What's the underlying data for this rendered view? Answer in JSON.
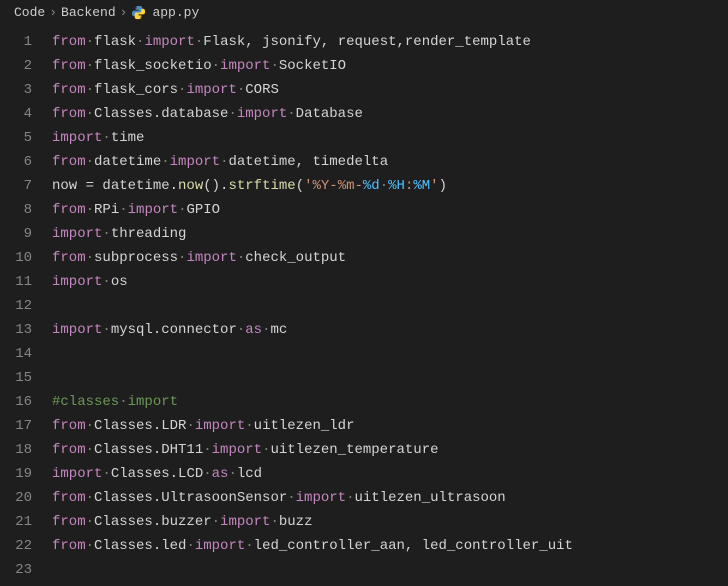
{
  "breadcrumb": {
    "items": [
      "Code",
      "Backend",
      "app.py"
    ],
    "file_icon": "python-icon"
  },
  "editor": {
    "lines": [
      {
        "num": "1",
        "tokens": [
          {
            "t": "from",
            "c": "keyword"
          },
          {
            "t": "·",
            "c": "dim"
          },
          {
            "t": "flask",
            "c": "module"
          },
          {
            "t": "·",
            "c": "dim"
          },
          {
            "t": "import",
            "c": "keyword"
          },
          {
            "t": "·",
            "c": "dim"
          },
          {
            "t": "Flask, jsonify, request,render_template",
            "c": "text"
          }
        ]
      },
      {
        "num": "2",
        "tokens": [
          {
            "t": "from",
            "c": "keyword"
          },
          {
            "t": "·",
            "c": "dim"
          },
          {
            "t": "flask_socketio",
            "c": "module"
          },
          {
            "t": "·",
            "c": "dim"
          },
          {
            "t": "import",
            "c": "keyword"
          },
          {
            "t": "·",
            "c": "dim"
          },
          {
            "t": "SocketIO",
            "c": "text"
          }
        ]
      },
      {
        "num": "3",
        "tokens": [
          {
            "t": "from",
            "c": "keyword"
          },
          {
            "t": "·",
            "c": "dim"
          },
          {
            "t": "flask_cors",
            "c": "module"
          },
          {
            "t": "·",
            "c": "dim"
          },
          {
            "t": "import",
            "c": "keyword"
          },
          {
            "t": "·",
            "c": "dim"
          },
          {
            "t": "CORS",
            "c": "text"
          }
        ]
      },
      {
        "num": "4",
        "tokens": [
          {
            "t": "from",
            "c": "keyword"
          },
          {
            "t": "·",
            "c": "dim"
          },
          {
            "t": "Classes.database",
            "c": "module"
          },
          {
            "t": "·",
            "c": "dim"
          },
          {
            "t": "import",
            "c": "keyword"
          },
          {
            "t": "·",
            "c": "dim"
          },
          {
            "t": "Database",
            "c": "text"
          }
        ]
      },
      {
        "num": "5",
        "tokens": [
          {
            "t": "import",
            "c": "keyword"
          },
          {
            "t": "·",
            "c": "dim"
          },
          {
            "t": "time",
            "c": "module"
          }
        ]
      },
      {
        "num": "6",
        "tokens": [
          {
            "t": "from",
            "c": "keyword"
          },
          {
            "t": "·",
            "c": "dim"
          },
          {
            "t": "datetime",
            "c": "module"
          },
          {
            "t": "·",
            "c": "dim"
          },
          {
            "t": "import",
            "c": "keyword"
          },
          {
            "t": "·",
            "c": "dim"
          },
          {
            "t": "datetime, timedelta",
            "c": "text"
          }
        ]
      },
      {
        "num": "7",
        "tokens": [
          {
            "t": "now ",
            "c": "text"
          },
          {
            "t": "=",
            "c": "operator"
          },
          {
            "t": " datetime.",
            "c": "text"
          },
          {
            "t": "now",
            "c": "func"
          },
          {
            "t": "().",
            "c": "text"
          },
          {
            "t": "strftime",
            "c": "func"
          },
          {
            "t": "(",
            "c": "text"
          },
          {
            "t": "'%Y-%m-",
            "c": "string"
          },
          {
            "t": "%d",
            "c": "const"
          },
          {
            "t": "·",
            "c": "dim"
          },
          {
            "t": "%H",
            "c": "const"
          },
          {
            "t": ":",
            "c": "string"
          },
          {
            "t": "%M",
            "c": "const"
          },
          {
            "t": "'",
            "c": "string"
          },
          {
            "t": ")",
            "c": "text"
          }
        ]
      },
      {
        "num": "8",
        "tokens": [
          {
            "t": "from",
            "c": "keyword"
          },
          {
            "t": "·",
            "c": "dim"
          },
          {
            "t": "RPi",
            "c": "module"
          },
          {
            "t": "·",
            "c": "dim"
          },
          {
            "t": "import",
            "c": "keyword"
          },
          {
            "t": "·",
            "c": "dim"
          },
          {
            "t": "GPIO",
            "c": "text"
          }
        ]
      },
      {
        "num": "9",
        "tokens": [
          {
            "t": "import",
            "c": "keyword"
          },
          {
            "t": "·",
            "c": "dim"
          },
          {
            "t": "threading",
            "c": "module"
          }
        ]
      },
      {
        "num": "10",
        "tokens": [
          {
            "t": "from",
            "c": "keyword"
          },
          {
            "t": "·",
            "c": "dim"
          },
          {
            "t": "subprocess",
            "c": "module"
          },
          {
            "t": "·",
            "c": "dim"
          },
          {
            "t": "import",
            "c": "keyword"
          },
          {
            "t": "·",
            "c": "dim"
          },
          {
            "t": "check_output",
            "c": "text"
          }
        ]
      },
      {
        "num": "11",
        "tokens": [
          {
            "t": "import",
            "c": "keyword"
          },
          {
            "t": "·",
            "c": "dim"
          },
          {
            "t": "os",
            "c": "module"
          }
        ]
      },
      {
        "num": "12",
        "tokens": []
      },
      {
        "num": "13",
        "tokens": [
          {
            "t": "import",
            "c": "keyword"
          },
          {
            "t": "·",
            "c": "dim"
          },
          {
            "t": "mysql.connector",
            "c": "module"
          },
          {
            "t": "·",
            "c": "dim"
          },
          {
            "t": "as",
            "c": "keyword"
          },
          {
            "t": "·",
            "c": "dim"
          },
          {
            "t": "mc",
            "c": "module"
          }
        ]
      },
      {
        "num": "14",
        "tokens": []
      },
      {
        "num": "15",
        "tokens": []
      },
      {
        "num": "16",
        "tokens": [
          {
            "t": "#classes",
            "c": "comment"
          },
          {
            "t": "·",
            "c": "dim"
          },
          {
            "t": "import",
            "c": "comment"
          }
        ]
      },
      {
        "num": "17",
        "tokens": [
          {
            "t": "from",
            "c": "keyword"
          },
          {
            "t": "·",
            "c": "dim"
          },
          {
            "t": "Classes.LDR",
            "c": "module"
          },
          {
            "t": "·",
            "c": "dim"
          },
          {
            "t": "import",
            "c": "keyword"
          },
          {
            "t": "·",
            "c": "dim"
          },
          {
            "t": "uitlezen_ldr",
            "c": "text"
          }
        ]
      },
      {
        "num": "18",
        "tokens": [
          {
            "t": "from",
            "c": "keyword"
          },
          {
            "t": "·",
            "c": "dim"
          },
          {
            "t": "Classes.DHT11",
            "c": "module"
          },
          {
            "t": "·",
            "c": "dim"
          },
          {
            "t": "import",
            "c": "keyword"
          },
          {
            "t": "·",
            "c": "dim"
          },
          {
            "t": "uitlezen_temperature",
            "c": "text"
          }
        ]
      },
      {
        "num": "19",
        "tokens": [
          {
            "t": "import",
            "c": "keyword"
          },
          {
            "t": "·",
            "c": "dim"
          },
          {
            "t": "Classes.LCD",
            "c": "module"
          },
          {
            "t": "·",
            "c": "dim"
          },
          {
            "t": "as",
            "c": "keyword"
          },
          {
            "t": "·",
            "c": "dim"
          },
          {
            "t": "lcd",
            "c": "module"
          }
        ]
      },
      {
        "num": "20",
        "tokens": [
          {
            "t": "from",
            "c": "keyword"
          },
          {
            "t": "·",
            "c": "dim"
          },
          {
            "t": "Classes.UltrasoonSensor",
            "c": "module"
          },
          {
            "t": "·",
            "c": "dim"
          },
          {
            "t": "import",
            "c": "keyword"
          },
          {
            "t": "·",
            "c": "dim"
          },
          {
            "t": "uitlezen_ultrasoon",
            "c": "text"
          }
        ]
      },
      {
        "num": "21",
        "tokens": [
          {
            "t": "from",
            "c": "keyword"
          },
          {
            "t": "·",
            "c": "dim"
          },
          {
            "t": "Classes.buzzer",
            "c": "module"
          },
          {
            "t": "·",
            "c": "dim"
          },
          {
            "t": "import",
            "c": "keyword"
          },
          {
            "t": "·",
            "c": "dim"
          },
          {
            "t": "buzz",
            "c": "text"
          }
        ]
      },
      {
        "num": "22",
        "tokens": [
          {
            "t": "from",
            "c": "keyword"
          },
          {
            "t": "·",
            "c": "dim"
          },
          {
            "t": "Classes.led",
            "c": "module"
          },
          {
            "t": "·",
            "c": "dim"
          },
          {
            "t": "import",
            "c": "keyword"
          },
          {
            "t": "·",
            "c": "dim"
          },
          {
            "t": "led_controller_aan, led_controller_uit",
            "c": "text"
          }
        ]
      },
      {
        "num": "23",
        "tokens": []
      }
    ]
  }
}
